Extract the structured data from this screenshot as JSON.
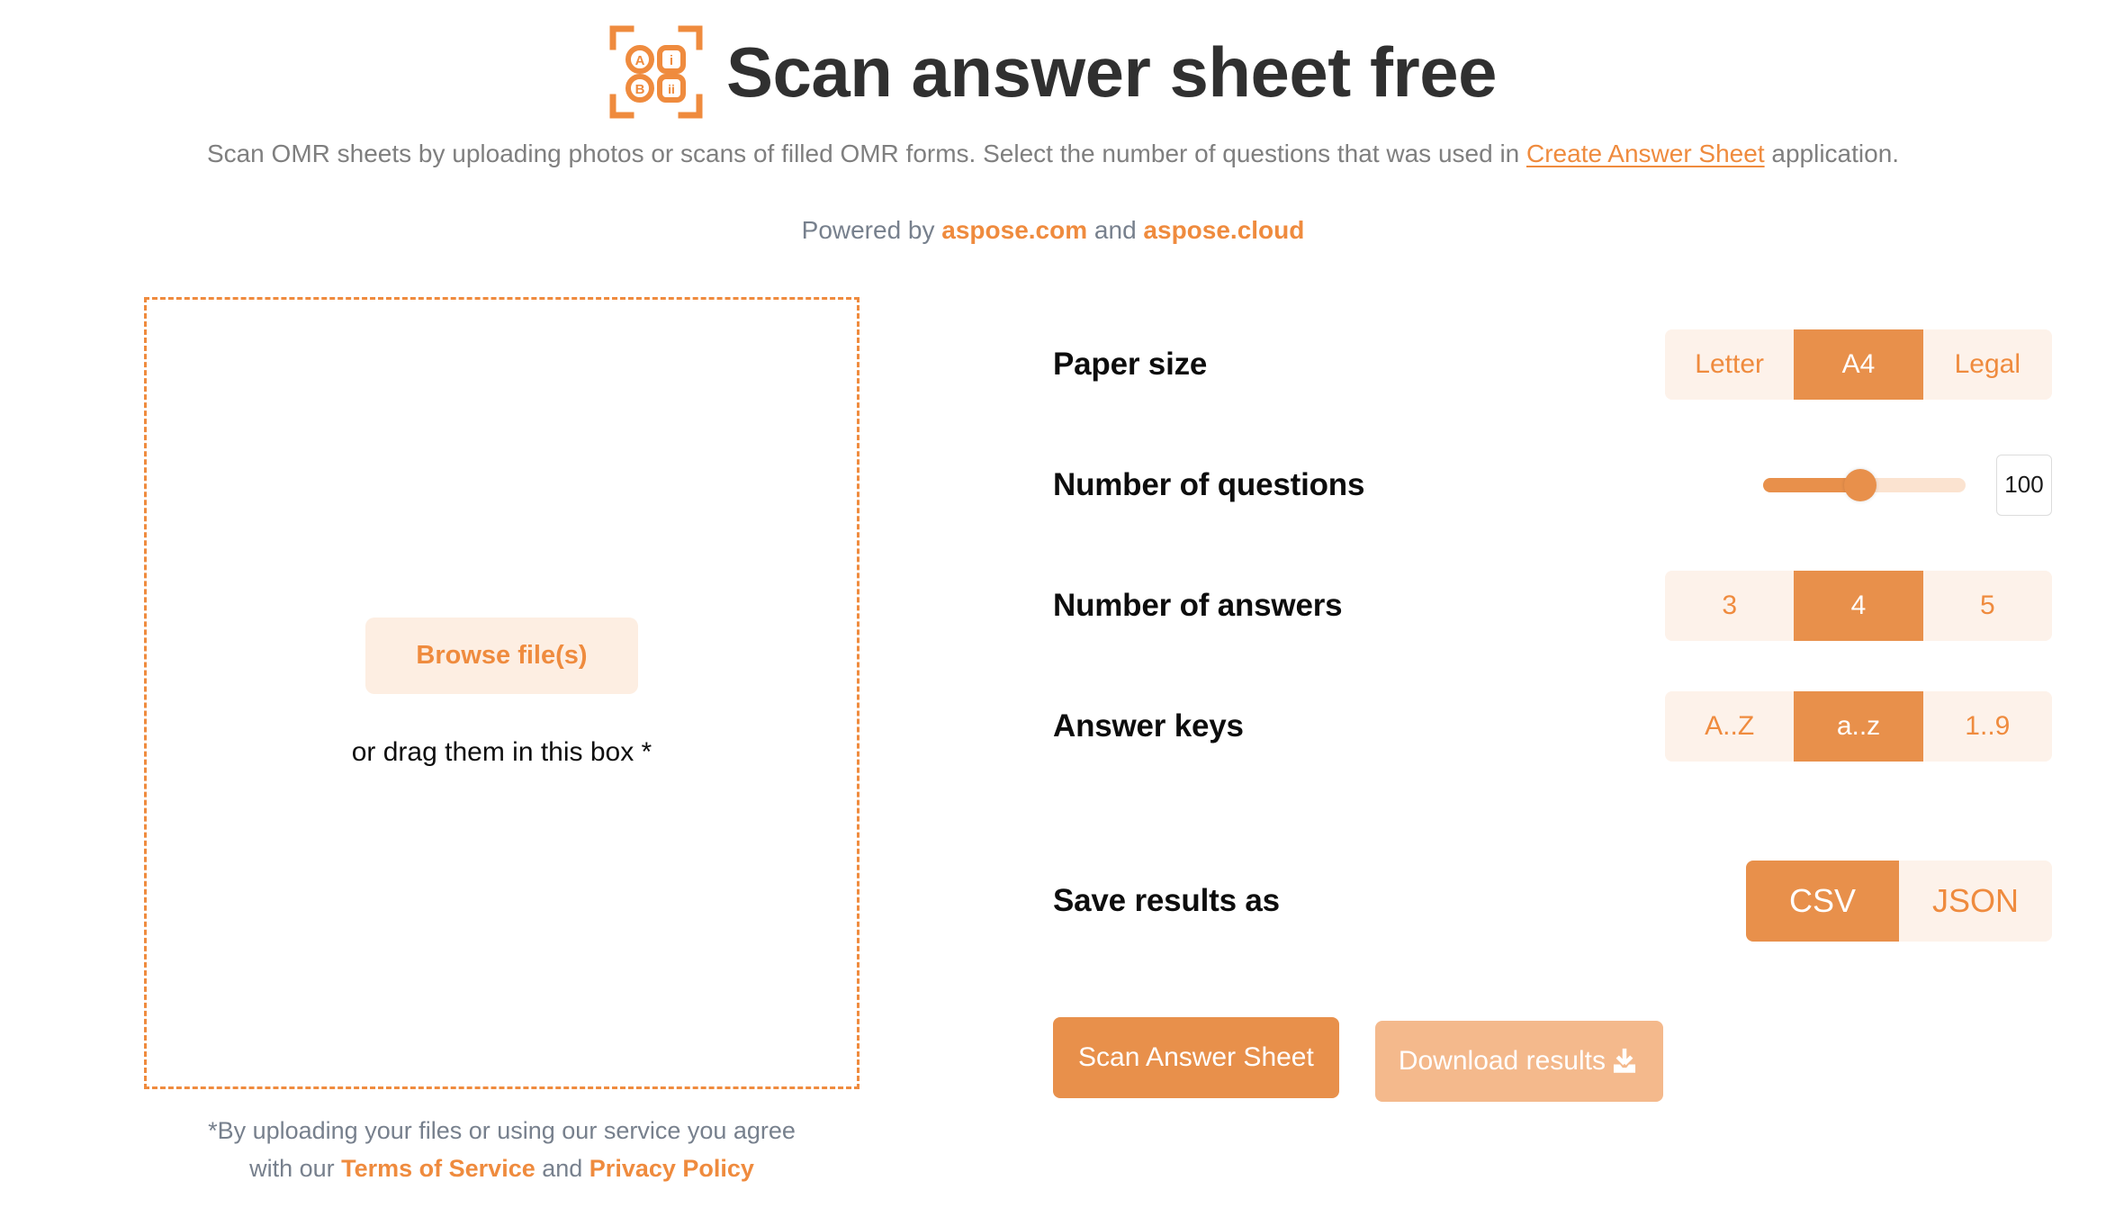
{
  "header": {
    "logo_icon": "omr-scan-logo-icon",
    "logo_cells": [
      "A",
      "B",
      "i",
      "ii"
    ],
    "title": "Scan answer sheet free",
    "subtitle_before": "Scan OMR sheets by uploading photos or scans of filled OMR forms. Select the number of questions that was used in ",
    "subtitle_link": "Create Answer Sheet",
    "subtitle_after": " application.",
    "powered_prefix": "Powered by ",
    "powered_link1": "aspose.com",
    "powered_middle": " and ",
    "powered_link2": "aspose.cloud"
  },
  "dropzone": {
    "browse_label": "Browse file(s)",
    "drag_text": "or drag them in this box *"
  },
  "legal": {
    "line1": "*By uploading your files or using our service you agree",
    "line2_prefix": "with our ",
    "terms_link": "Terms of Service",
    "line2_middle": " and ",
    "privacy_link": "Privacy Policy"
  },
  "settings": {
    "paper_size": {
      "label": "Paper size",
      "options": [
        "Letter",
        "A4",
        "Legal"
      ],
      "selected": "A4"
    },
    "number_of_questions": {
      "label": "Number of questions",
      "value": "100",
      "slider_percent": 48
    },
    "number_of_answers": {
      "label": "Number of answers",
      "options": [
        "3",
        "4",
        "5"
      ],
      "selected": "4"
    },
    "answer_keys": {
      "label": "Answer keys",
      "options": [
        "A..Z",
        "a..z",
        "1..9"
      ],
      "selected": "a..z"
    },
    "save_results_as": {
      "label": "Save results as",
      "options": [
        "CSV",
        "JSON"
      ],
      "selected": "CSV"
    }
  },
  "actions": {
    "scan_label": "Scan Answer Sheet",
    "download_label": "Download results",
    "download_icon": "download-icon"
  },
  "colors": {
    "accent": "#ef8b3e",
    "accent_active": "#e8904b",
    "accent_soft": "#fdf2ea",
    "accent_disabled": "#f4b98c",
    "muted_text": "#77808d",
    "title": "#303030"
  }
}
